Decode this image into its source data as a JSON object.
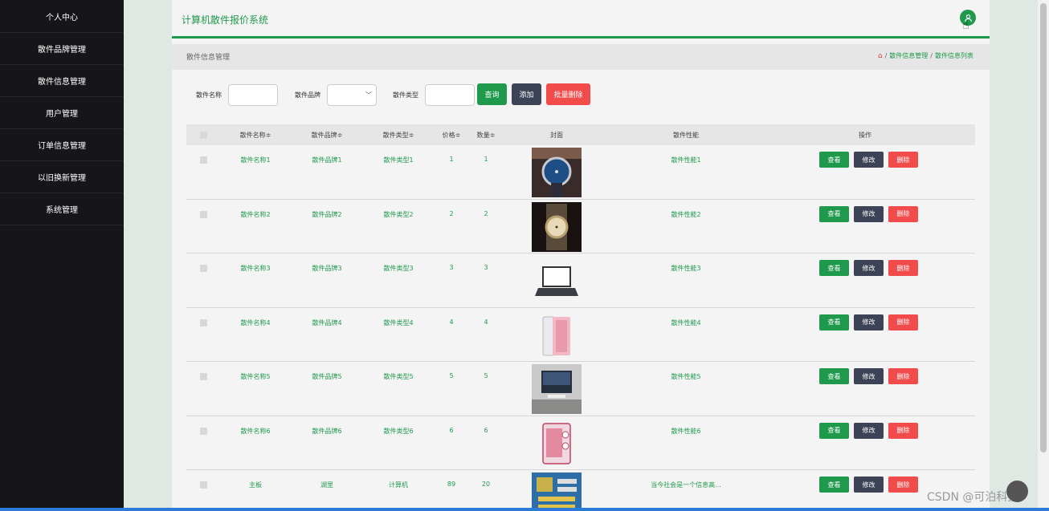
{
  "sidebar": {
    "items": [
      {
        "label": "个人中心"
      },
      {
        "label": "散件品牌管理"
      },
      {
        "label": "散件信息管理"
      },
      {
        "label": "用户管理"
      },
      {
        "label": "订单信息管理"
      },
      {
        "label": "以旧换新管理"
      },
      {
        "label": "系统管理"
      }
    ]
  },
  "header": {
    "title": "计算机散件报价系统",
    "avatar_icon": "user-icon"
  },
  "breadcrumb": {
    "page_title": "散件信息管理",
    "home_icon": "home-icon",
    "sep": "/",
    "item1": "散件信息管理",
    "item2": "散件信息列表"
  },
  "filters": {
    "name_label": "散件名称",
    "brand_label": "散件品牌",
    "type_label": "散件类型",
    "query_btn": "查询",
    "add_btn": "添加",
    "batch_delete_btn": "批量删除"
  },
  "table": {
    "headers": {
      "name": "散件名称",
      "brand": "散件品牌",
      "type": "散件类型",
      "price": "价格",
      "qty": "数量",
      "cover": "封面",
      "perf": "散件性能",
      "ops": "操作"
    },
    "sort_icon": "≑",
    "row_buttons": {
      "view": "查看",
      "edit": "修改",
      "delete": "删除"
    },
    "rows": [
      {
        "name": "散件名称1",
        "brand": "散件品牌1",
        "type": "散件类型1",
        "price": "1",
        "qty": "1",
        "cover": "watch",
        "perf": "散件性能1"
      },
      {
        "name": "散件名称2",
        "brand": "散件品牌2",
        "type": "散件类型2",
        "price": "2",
        "qty": "2",
        "cover": "watch-gold",
        "perf": "散件性能2"
      },
      {
        "name": "散件名称3",
        "brand": "散件品牌3",
        "type": "散件类型3",
        "price": "3",
        "qty": "3",
        "cover": "laptop",
        "perf": "散件性能3"
      },
      {
        "name": "散件名称4",
        "brand": "散件品牌4",
        "type": "散件类型4",
        "price": "4",
        "qty": "4",
        "cover": "phone",
        "perf": "散件性能4"
      },
      {
        "name": "散件名称5",
        "brand": "散件品牌5",
        "type": "散件类型5",
        "price": "5",
        "qty": "5",
        "cover": "tv",
        "perf": "散件性能5"
      },
      {
        "name": "散件名称6",
        "brand": "散件品牌6",
        "type": "散件类型6",
        "price": "6",
        "qty": "6",
        "cover": "pc-case",
        "perf": "散件性能6"
      },
      {
        "name": "主板",
        "brand": "湖里",
        "type": "计算机",
        "price": "89",
        "qty": "20",
        "cover": "motherboard",
        "perf": "当今社会是一个信息高..."
      }
    ]
  },
  "watermark": "CSDN @可泊科技",
  "colors": {
    "accent": "#1f9a4d",
    "dark_button": "#3d4356",
    "danger": "#f24b4b",
    "sidebar_bg": "#16161a"
  }
}
